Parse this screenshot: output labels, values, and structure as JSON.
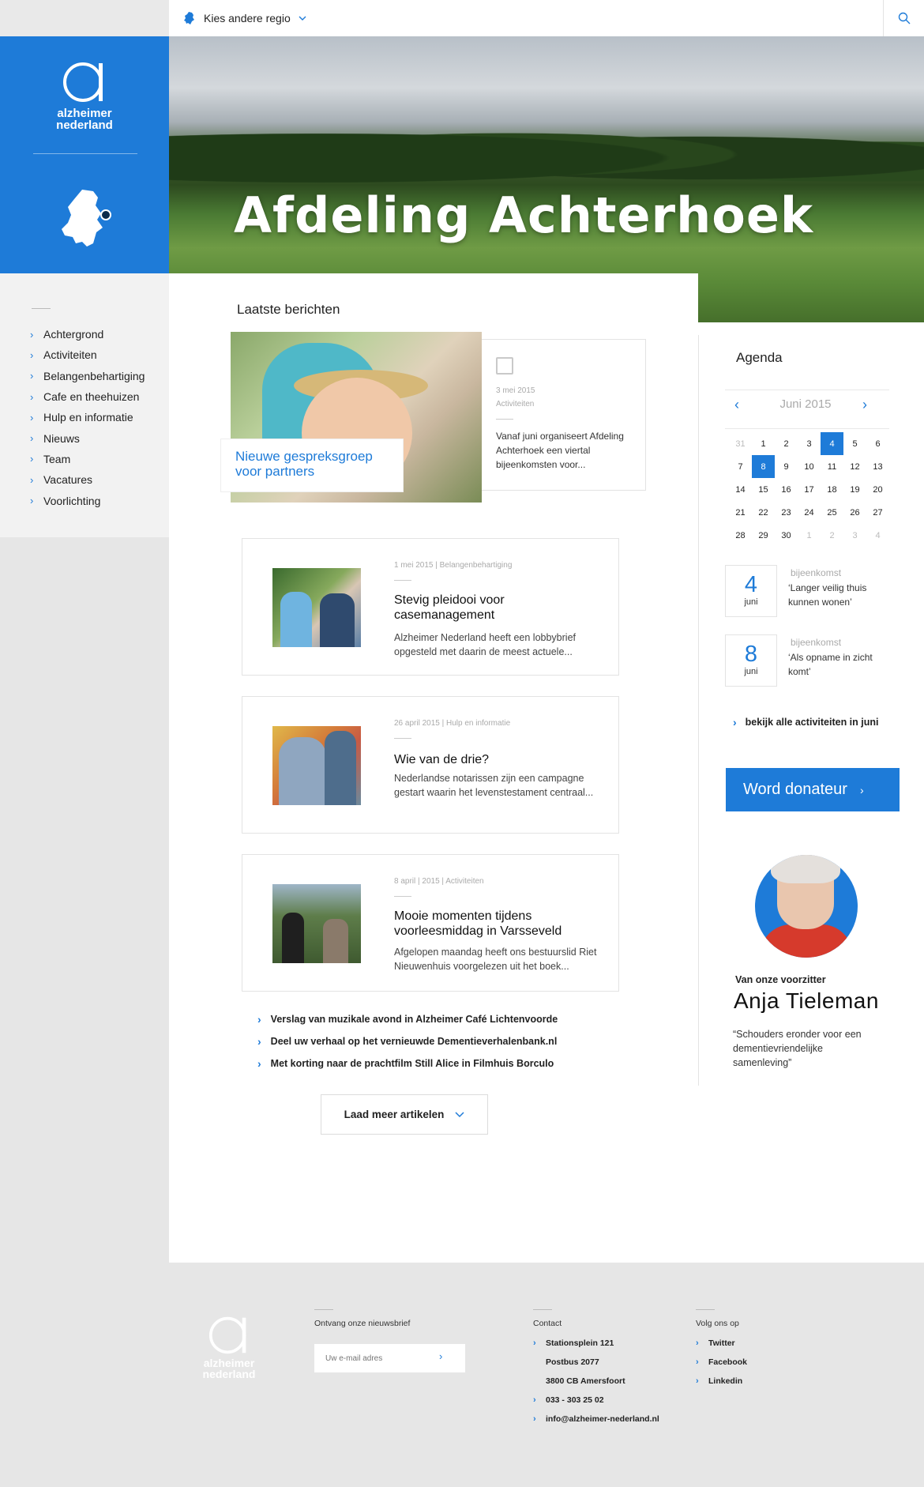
{
  "topbar": {
    "region_label": "Kies andere regio"
  },
  "brand": {
    "name_line1": "alzheimer",
    "name_line2": "nederland"
  },
  "hero": {
    "title": "Afdeling Achterhoek"
  },
  "sidebar": {
    "items": [
      {
        "label": "Achtergrond"
      },
      {
        "label": "Activiteiten"
      },
      {
        "label": "Belangenbehartiging"
      },
      {
        "label": "Cafe en theehuizen"
      },
      {
        "label": "Hulp en informatie"
      },
      {
        "label": "Nieuws"
      },
      {
        "label": "Team"
      },
      {
        "label": "Vacatures"
      },
      {
        "label": "Voorlichting"
      }
    ]
  },
  "latest": {
    "title": "Laatste berichten",
    "featured": {
      "caption": "Nieuwe gespreksgroep voor partners",
      "date": "3 mei 2015",
      "category": "Activiteiten",
      "excerpt": "Vanaf juni organiseert Afdeling Achterhoek een viertal bijeenkomsten voor..."
    },
    "articles": [
      {
        "meta": "1 mei 2015   | Belangenbehartiging",
        "title": "Stevig pleidooi voor casemanagement",
        "excerpt": "Alzheimer Nederland heeft een lobbybrief opgesteld met daarin de meest actuele..."
      },
      {
        "meta": "26 april 2015  | Hulp en informatie",
        "title": "Wie van de drie?",
        "excerpt": "Nederlandse notarissen zijn een campagne gestart waarin het levenstestament centraal..."
      },
      {
        "meta": "8 april | 2015   | Activiteiten",
        "title": "Mooie momenten tijdens voorleesmiddag in Varsseveld",
        "excerpt": "Afgelopen maandag heeft ons bestuurslid Riet Nieuwenhuis voorgelezen uit het boek..."
      }
    ],
    "links": [
      "Verslag van muzikale avond in Alzheimer Café Lichtenvoorde",
      "Deel uw verhaal op het vernieuwde Dementieverhalenbank.nl",
      "Met korting naar de prachtfilm Still Alice in Filmhuis Borculo"
    ],
    "load_more": "Laad meer artikelen"
  },
  "agenda": {
    "title": "Agenda",
    "month": "Juni 2015",
    "days": [
      {
        "d": "31",
        "muted": true
      },
      {
        "d": "1"
      },
      {
        "d": "2"
      },
      {
        "d": "3"
      },
      {
        "d": "4",
        "sel": true
      },
      {
        "d": "5"
      },
      {
        "d": "6"
      },
      {
        "d": "7"
      },
      {
        "d": "8",
        "sel": true
      },
      {
        "d": "9"
      },
      {
        "d": "10"
      },
      {
        "d": "11"
      },
      {
        "d": "12"
      },
      {
        "d": "13"
      },
      {
        "d": "14"
      },
      {
        "d": "15"
      },
      {
        "d": "16"
      },
      {
        "d": "17"
      },
      {
        "d": "18"
      },
      {
        "d": "19"
      },
      {
        "d": "20"
      },
      {
        "d": "21"
      },
      {
        "d": "22"
      },
      {
        "d": "23"
      },
      {
        "d": "24"
      },
      {
        "d": "25"
      },
      {
        "d": "26"
      },
      {
        "d": "27"
      },
      {
        "d": "28"
      },
      {
        "d": "29"
      },
      {
        "d": "30"
      },
      {
        "d": "1",
        "muted": true
      },
      {
        "d": "2",
        "muted": true
      },
      {
        "d": "3",
        "muted": true
      },
      {
        "d": "4",
        "muted": true
      }
    ],
    "events": [
      {
        "day": "4",
        "month": "juni",
        "type": "bijeenkomst",
        "desc": "‘Langer veilig thuis kunnen wonen’"
      },
      {
        "day": "8",
        "month": "juni",
        "type": "bijeenkomst",
        "desc": "‘Als opname in zicht komt’"
      }
    ],
    "all_link": "bekijk alle activiteiten in juni"
  },
  "donate": {
    "label": "Word donateur"
  },
  "chair": {
    "label": "Van onze voorzitter",
    "name": "Anja Tieleman",
    "quote": "“Schouders eronder voor een dementievriendelijke samenleving”"
  },
  "footer": {
    "newsletter": {
      "heading": "Ontvang onze nieuwsbrief",
      "placeholder": "Uw e-mail adres"
    },
    "contact": {
      "heading": "Contact",
      "address1": "Stationsplein 121",
      "address2": "Postbus 2077",
      "address3": "3800 CB Amersfoort",
      "phone": "033 - 303 25 02",
      "email": "info@alzheimer-nederland.nl"
    },
    "social": {
      "heading": "Volg ons op",
      "items": [
        "Twitter",
        "Facebook",
        "Linkedin"
      ]
    }
  },
  "colors": {
    "brand_blue": "#1e7bd8",
    "background_grey": "#e6e6e6"
  }
}
